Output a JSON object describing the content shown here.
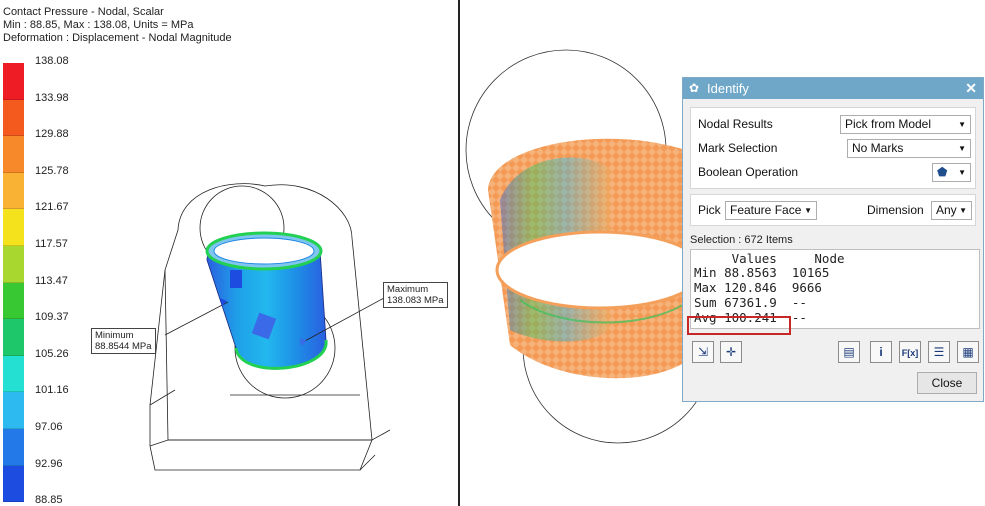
{
  "left_panel": {
    "header_line1": "Contact Pressure - Nodal, Scalar",
    "header_line2": "Min : 88.85, Max : 138.08, Units = MPa",
    "header_line3": "Deformation : Displacement - Nodal Magnitude",
    "legend_labels": [
      "138.08",
      "133.98",
      "129.88",
      "125.78",
      "121.67",
      "117.57",
      "113.47",
      "109.37",
      "105.26",
      "101.16",
      "97.06",
      "92.96",
      "88.85"
    ],
    "legend_colors": [
      "#ee1c24",
      "#f45a1e",
      "#f7892a",
      "#f9b233",
      "#f4e21c",
      "#a8d830",
      "#38c833",
      "#1ec86a",
      "#24e0d2",
      "#2cbaf0",
      "#2479e8",
      "#1c4ce0",
      "#1020c8"
    ],
    "callout_min_title": "Minimum",
    "callout_min_value": "88.8544 MPa",
    "callout_max_title": "Maximum",
    "callout_max_value": "138.083 MPa"
  },
  "dialog": {
    "title": "Identify",
    "nodal_results_label": "Nodal Results",
    "nodal_results_value": "Pick from Model",
    "mark_selection_label": "Mark Selection",
    "mark_selection_value": "No Marks",
    "boolean_label": "Boolean Operation",
    "pick_label": "Pick",
    "pick_value": "Feature Face",
    "dimension_label": "Dimension",
    "dimension_value": "Any",
    "selection_text": "Selection : 672 Items",
    "results_header": "     Values     Node",
    "results_min": "Min 88.8563  10165",
    "results_max": "Max 120.846  9666",
    "results_sum": "Sum 67361.9  --",
    "results_avg": "Avg 100.241  --",
    "close_label": "Close"
  }
}
